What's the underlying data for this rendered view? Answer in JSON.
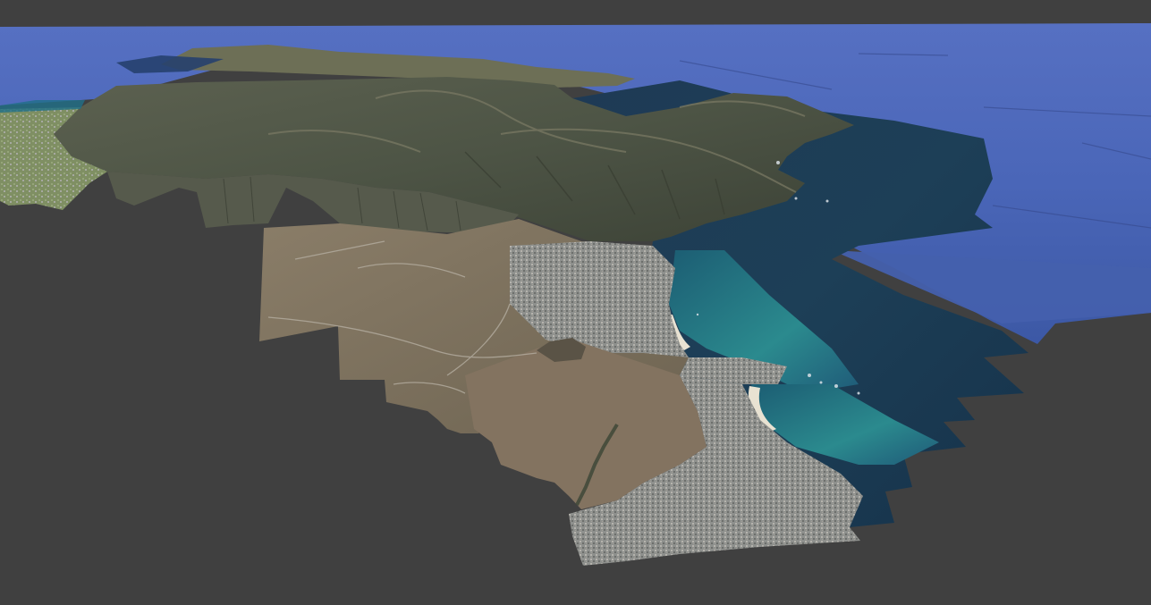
{
  "viewport": {
    "background_color": "#404040",
    "scene": "3d-terrain-tiles"
  },
  "colors": {
    "ocean_far": "#4a66b8",
    "ocean_mid": "#3f5aa8",
    "ocean_near": "#1d3f57",
    "shallow_water": "#2b8a8e",
    "beach_sand": "#e8e2d2",
    "mountain_dark": "#4d5445",
    "mountain_mid": "#6b6a56",
    "slope_brown": "#7e7260",
    "urban_gray": "#8d8f8e",
    "vegetation": "#7d9060"
  }
}
